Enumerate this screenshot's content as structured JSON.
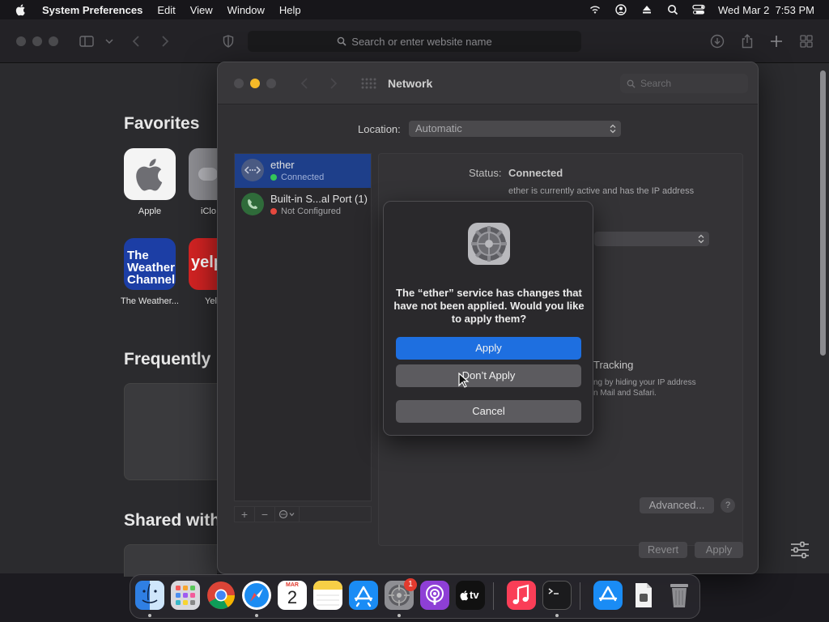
{
  "menubar": {
    "app": "System Preferences",
    "items": [
      "Edit",
      "View",
      "Window",
      "Help"
    ],
    "datetime": "Wed Mar 2  7:53 PM",
    "status_icons": [
      "wifi-icon",
      "user-icon",
      "eject-icon",
      "search-icon",
      "control-center-icon"
    ]
  },
  "safari": {
    "address_placeholder": "Search or enter website name",
    "sections": {
      "favorites": "Favorites",
      "frequently": "Frequently",
      "shared": "Shared with"
    },
    "favorites": [
      {
        "label": "Apple",
        "icon": "apple-icon"
      },
      {
        "label": "iClo",
        "icon": "icloud-icon"
      },
      {
        "label": "The Weather...",
        "icon": "weather-channel-icon",
        "tile_text": "The Weather Channel"
      },
      {
        "label": "Yel",
        "icon": "yelp-icon",
        "tile_text": "yelp"
      }
    ]
  },
  "sysprefs": {
    "title": "Network",
    "search_placeholder": "Search",
    "location_label": "Location:",
    "location_value": "Automatic",
    "services": [
      {
        "name": "ether",
        "status": "Connected",
        "status_color": "#34c759",
        "icon": "ethernet-icon"
      },
      {
        "name": "Built-in S...al Port (1)",
        "status": "Not Configured",
        "status_color": "#e5483e",
        "icon": "phone-icon"
      }
    ],
    "status_label": "Status:",
    "status_value": "Connected",
    "status_desc": "ether is currently active and has the IP address",
    "tracking_title": "Tracking",
    "tracking_desc": "ng by hiding your IP address\nn Mail and Safari.",
    "advanced": "Advanced...",
    "help": "?",
    "revert": "Revert",
    "apply": "Apply"
  },
  "dialog": {
    "message": "The “ether” service has changes that have not been applied. Would you like to apply them?",
    "apply": "Apply",
    "dont_apply": "Don’t Apply",
    "cancel": "Cancel"
  },
  "dock": {
    "calendar_month": "MAR",
    "calendar_day": "2",
    "tv_label": "tv",
    "badge": "1",
    "apps": [
      "finder",
      "launchpad",
      "chrome",
      "safari",
      "calendar",
      "notes",
      "app-store",
      "system-preferences",
      "podcasts",
      "apple-tv",
      "music",
      "terminal",
      "app-store-downloads",
      "preview",
      "trash"
    ]
  },
  "colors": {
    "accent": "#1e6fe0",
    "connected": "#34c759",
    "not_configured": "#e5483e"
  }
}
